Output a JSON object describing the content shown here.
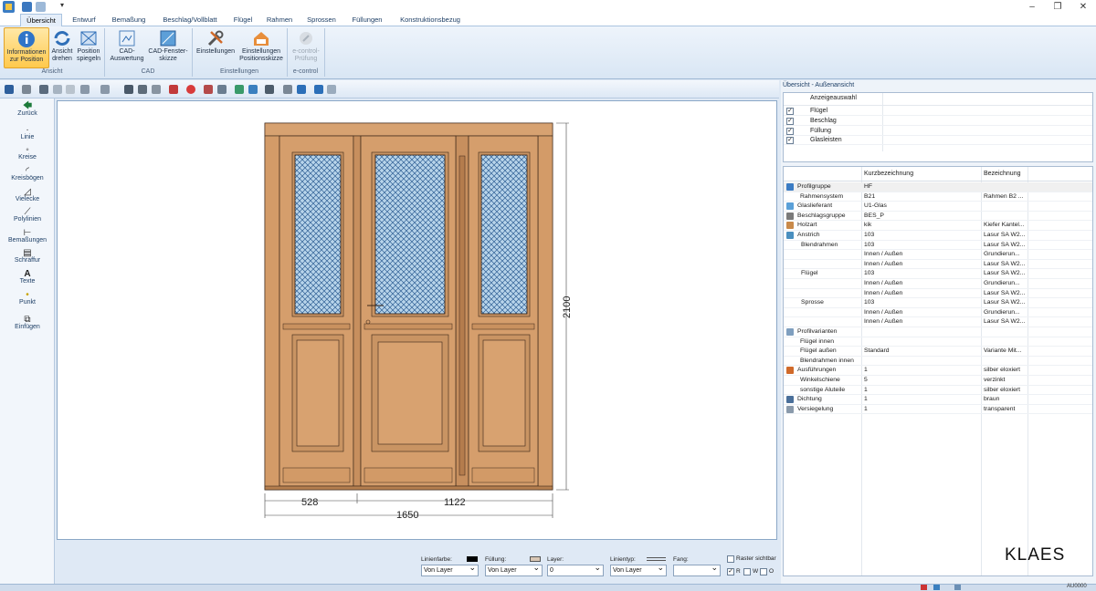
{
  "ribbon": {
    "tabs": [
      "Übersicht",
      "Entwurf",
      "Bemaßung",
      "Beschlag/Vollblatt",
      "Flügel",
      "Rahmen",
      "Sprossen",
      "Füllungen",
      "Konstruktionsbezug"
    ],
    "buttons": {
      "info": "Informationen zur Position",
      "rotate": "Ansicht drehen",
      "mirror": "Position spiegeln",
      "cad_eval": "CAD-Auswertung",
      "cad_sketch": "CAD-Fenster­skizze",
      "settings": "Einstellungen",
      "pos_settings": "Einstellungen Positionsskizze",
      "econtrol": "e-control-Prüfung"
    },
    "groups": {
      "ansicht": "Ansicht",
      "cad": "CAD",
      "einstellungen": "Einstellungen",
      "econtrol": "e-control"
    }
  },
  "left_tools": [
    "Zurück",
    "Linie",
    "Kreise",
    "Kreisbögen",
    "Vielecke",
    "Polylinien",
    "Bemaßungen",
    "Schraffur",
    "Texte",
    "Punkt",
    "Einfügen"
  ],
  "drawing": {
    "height_dim": "2100",
    "width_left": "528",
    "width_right": "1122",
    "width_total": "1650"
  },
  "layerbar": {
    "linienfarbe_label": "Linienfarbe:",
    "fuellung_label": "Füllung:",
    "layer_label": "Layer:",
    "linientyp_label": "Linientyp:",
    "fang_label": "Fang:",
    "raster_label": "Raster sichtbar",
    "sel_linienfarbe": "Von Layer",
    "sel_fuellung": "Von Layer",
    "sel_layer": "0",
    "sel_linientyp": "Von Layer",
    "sel_fang": "",
    "opt_r": "R",
    "opt_w": "W",
    "opt_o": "O"
  },
  "right_panel": {
    "title": "Übersicht - Außenansicht",
    "anzeige_header": "Anzeigeauswahl",
    "anzeige_items": [
      "Flügel",
      "Beschlag",
      "Füllung",
      "Glasleisten"
    ],
    "col_kurz": "Kurzbezeichnung",
    "col_bez": "Bezeichnung",
    "rows": [
      {
        "name": "Profilgruppe",
        "kurz": "HF",
        "bez": "",
        "ind": 0,
        "icon": "profile-icon"
      },
      {
        "name": "Rahmensystem",
        "kurz": "B21",
        "bez": "Rahmen B2 ...",
        "ind": 1
      },
      {
        "name": "Glaslieferant",
        "kurz": "U1-Glas",
        "bez": "",
        "ind": 0,
        "icon": "glass-icon"
      },
      {
        "name": "Beschlagsgruppe",
        "kurz": "BES_P",
        "bez": "",
        "ind": 0,
        "icon": "hardware-icon"
      },
      {
        "name": "Holzart",
        "kurz": "kik",
        "bez": "Kiefer Kantel...",
        "ind": 0,
        "icon": "wood-icon"
      },
      {
        "name": "Anstrich",
        "kurz": "103",
        "bez": "Lasur SA W2...",
        "ind": 0,
        "icon": "paint-icon"
      },
      {
        "name": "Blendrahmen",
        "kurz": "103",
        "bez": "Lasur SA W2...",
        "ind": 2
      },
      {
        "name": "",
        "kurz": "Innen / Außen",
        "bez": "Grundierun...",
        "ind": 2
      },
      {
        "name": "",
        "kurz": "Innen / Außen",
        "bez": "Lasur SA W2...",
        "ind": 2
      },
      {
        "name": "Flügel",
        "kurz": "103",
        "bez": "Lasur SA W2...",
        "ind": 2
      },
      {
        "name": "",
        "kurz": "Innen / Außen",
        "bez": "Grundierun...",
        "ind": 2
      },
      {
        "name": "",
        "kurz": "Innen / Außen",
        "bez": "Lasur SA W2...",
        "ind": 2
      },
      {
        "name": "Sprosse",
        "kurz": "103",
        "bez": "Lasur SA W2...",
        "ind": 2
      },
      {
        "name": "",
        "kurz": "Innen / Außen",
        "bez": "Grundierun...",
        "ind": 2
      },
      {
        "name": "",
        "kurz": "Innen / Außen",
        "bez": "Lasur SA W2...",
        "ind": 2
      },
      {
        "name": "Profilvarianten",
        "kurz": "",
        "bez": "",
        "ind": 0,
        "icon": "variants-icon"
      },
      {
        "name": "Flügel innen",
        "kurz": "",
        "bez": "",
        "ind": 1
      },
      {
        "name": "Flügel außen",
        "kurz": "Standard",
        "bez": "Variante Mit...",
        "ind": 1
      },
      {
        "name": "Blendrahmen innen",
        "kurz": "",
        "bez": "",
        "ind": 1
      },
      {
        "name": "Ausführungen",
        "kurz": "1",
        "bez": "silber eloxiert",
        "ind": 0,
        "icon": "finish-icon"
      },
      {
        "name": "Winkelschiene",
        "kurz": "5",
        "bez": "verzinkt",
        "ind": 1
      },
      {
        "name": "sonstige Aluteile",
        "kurz": "1",
        "bez": "silber eloxiert",
        "ind": 1
      },
      {
        "name": "Dichtung",
        "kurz": "1",
        "bez": "braun",
        "ind": 0,
        "icon": "seal-icon"
      },
      {
        "name": "Versiegelung",
        "kurz": "1",
        "bez": "transparent",
        "ind": 0,
        "icon": "sealing-icon"
      }
    ]
  },
  "brand": "KLAES",
  "status": {
    "code": "AU0000"
  }
}
